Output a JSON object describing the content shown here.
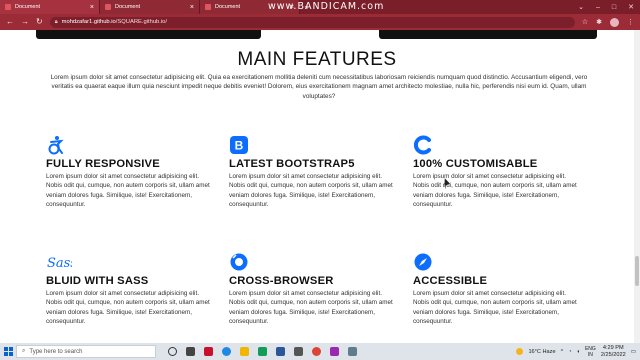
{
  "browser": {
    "tabs": [
      {
        "label": "Document",
        "active": true
      },
      {
        "label": "Document",
        "active": false
      },
      {
        "label": "Document",
        "active": false
      }
    ],
    "new_tab": "+",
    "watermark": "www.BANDICAM.com",
    "url_host": "mohdzafar1.github.io",
    "url_path": "/SQUARE.github.io/"
  },
  "page": {
    "title": "MAIN FEATURES",
    "intro": "Lorem ipsum dolor sit amet consectetur adipisicing elit. Quia ea exercitationem mollitia deleniti cum necessitatibus laboriosam reiciendis numquam quod distinctio. Accusantium eligendi, vero veritatis ea quaerat eaque illum quia nesciunt impedit neque debitis eveniet! Dolorem, eius exercitationem magnam amet architecto molestiae, nulla hic, perferendis nisi eum id. Quam, ullam voluptates?",
    "features": [
      {
        "icon": "accessibility-icon",
        "title": "FULLY RESPONSIVE",
        "text": "Lorem ipsum dolor sit amet consectetur adipisicing elit. Nobis odit qui, cumque, non autem corporis sit, ullam amet veniam dolores fuga. Similique, iste! Exercitationem, consequuntur."
      },
      {
        "icon": "bootstrap-icon",
        "title": "LATEST BOOTSTRAP5",
        "text": "Lorem ipsum dolor sit amet consectetur adipisicing elit. Nobis odit qui, cumque, non autem corporis sit, ullam amet veniam dolores fuga. Similique, iste! Exercitationem, consequuntur."
      },
      {
        "icon": "customise-icon",
        "title": "100% CUSTOMISABLE",
        "text": "Lorem ipsum dolor sit amet consectetur adipisicing elit. Nobis odit qui, cumque, non autem corporis sit, ullam amet veniam dolores fuga. Similique, iste! Exercitationem, consequuntur."
      },
      {
        "icon": "sass-icon",
        "title": "BLUID WITH SASS",
        "text": "Lorem ipsum dolor sit amet consectetur adipisicing elit. Nobis odit qui, cumque, non autem corporis sit, ullam amet veniam dolores fuga. Similique, iste! Exercitationem, consequuntur."
      },
      {
        "icon": "cross-browser-icon",
        "title": "CROSS-BROWSER",
        "text": "Lorem ipsum dolor sit amet consectetur adipisicing elit. Nobis odit qui, cumque, non autem corporis sit, ullam amet veniam dolores fuga. Similique, iste! Exercitationem, consequuntur."
      },
      {
        "icon": "compass-icon",
        "title": "ACCESSIBLE",
        "text": "Lorem ipsum dolor sit amet consectetur adipisicing elit. Nobis odit qui, cumque, non autem corporis sit, ullam amet veniam dolores fuga. Similique, iste! Exercitationem, consequuntur."
      }
    ],
    "sass_label": "Sass",
    "accent": "#0d6efd"
  },
  "taskbar": {
    "search_placeholder": "Type here to search",
    "weather": "16°C Haze",
    "lang_top": "ENG",
    "lang_bottom": "IN",
    "time": "4:29 PM",
    "date": "2/25/2022"
  }
}
